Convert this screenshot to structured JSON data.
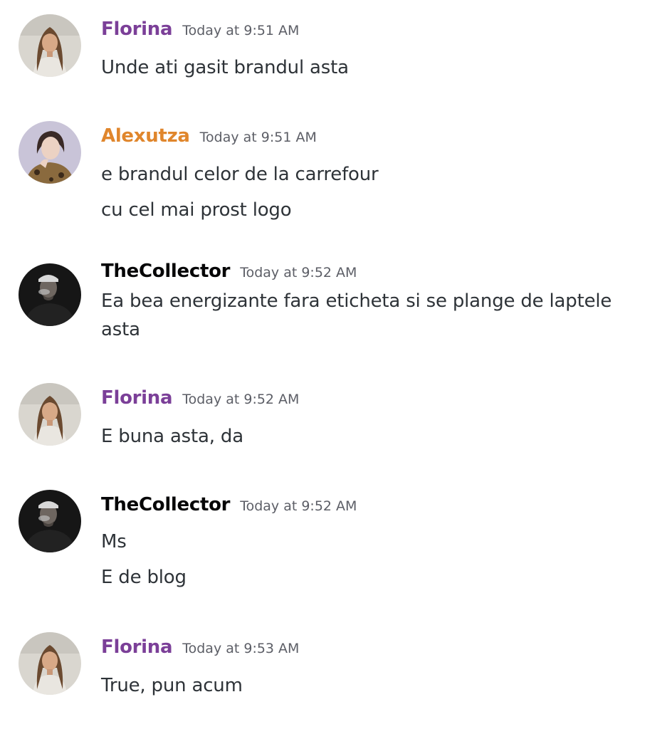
{
  "colors": {
    "florina": "#7b3f98",
    "alexutza": "#e0862c",
    "thecollector": "#060607",
    "timestamp": "#5c5e66",
    "message_text": "#2e3338"
  },
  "messages": [
    {
      "username": "Florina",
      "timestamp": "Today at 9:51 AM",
      "lines": [
        "Unde ati gasit brandul asta"
      ]
    },
    {
      "username": "Alexutza",
      "timestamp": "Today at 9:51 AM",
      "lines": [
        "e brandul celor de la carrefour",
        "cu cel mai prost logo"
      ]
    },
    {
      "username": "TheCollector",
      "timestamp": "Today at 9:52 AM",
      "lines": [
        "Ea bea energizante fara eticheta si se plange de laptele",
        "asta"
      ]
    },
    {
      "username": "Florina",
      "timestamp": "Today at 9:52 AM",
      "lines": [
        "E buna asta, da"
      ]
    },
    {
      "username": "TheCollector",
      "timestamp": "Today at 9:52 AM",
      "lines": [
        "Ms",
        "E de blog"
      ]
    },
    {
      "username": "Florina",
      "timestamp": "Today at 9:53 AM",
      "lines": [
        "True, pun acum"
      ]
    }
  ]
}
